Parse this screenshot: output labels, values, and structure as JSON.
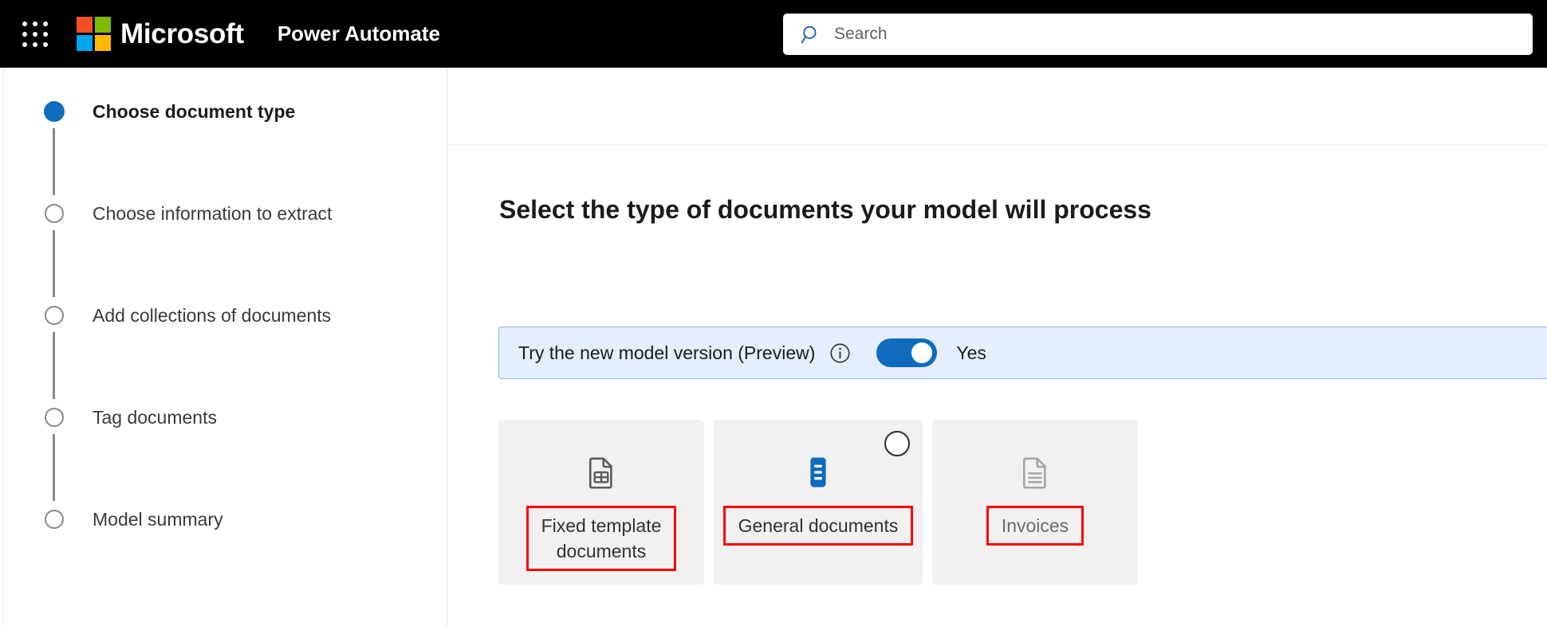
{
  "suite_bar": {
    "waffle_icon": "app-launcher-waffle-icon",
    "brand": "Microsoft",
    "app_name": "Power Automate",
    "search": {
      "icon": "search-icon",
      "placeholder": "Search",
      "value": ""
    }
  },
  "sidebar": {
    "steps": [
      {
        "label": "Choose document type",
        "state": "active"
      },
      {
        "label": "Choose information to extract",
        "state": "pending"
      },
      {
        "label": "Add collections of documents",
        "state": "pending"
      },
      {
        "label": "Tag documents",
        "state": "pending"
      },
      {
        "label": "Model summary",
        "state": "pending"
      }
    ]
  },
  "main": {
    "title": "Select the type of documents your model will process",
    "preview_banner": {
      "text": "Try the new model version (Preview)",
      "info_icon": "info-circle-icon",
      "toggle": {
        "state": "on",
        "label": "Yes"
      },
      "background": "#e4eefc",
      "border": "#8ab4f1"
    },
    "document_types": [
      {
        "label": "Fixed template\ndocuments",
        "icon": "document-table-icon",
        "icon_color": "#5c5c5c",
        "selected": false,
        "highlighted": true
      },
      {
        "label": "General documents",
        "icon": "document-lines-filled-icon",
        "icon_color": "#0f6cbd",
        "selected": false,
        "radio": "unselected-radio-icon",
        "highlighted": true
      },
      {
        "label": "Invoices",
        "icon": "document-invoice-icon",
        "icon_color": "#a6a6a6",
        "selected": false,
        "highlighted": true
      }
    ],
    "annotation_color": "#ff0000"
  }
}
